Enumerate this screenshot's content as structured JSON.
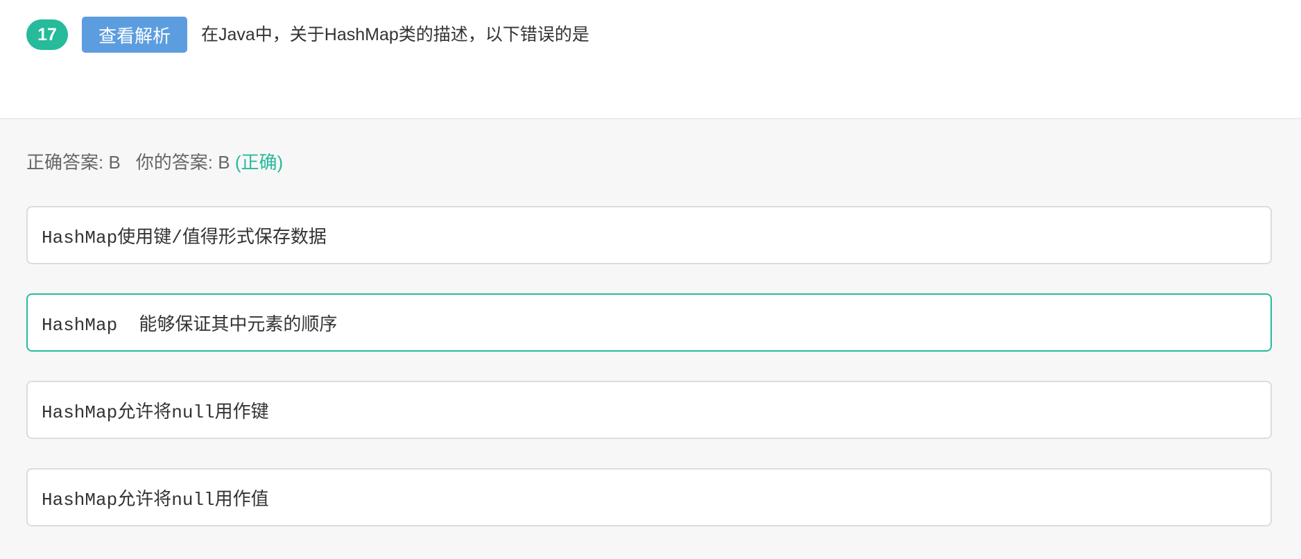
{
  "question": {
    "number": "17",
    "analysis_button_label": "查看解析",
    "text": "在Java中，关于HashMap类的描述，以下错误的是"
  },
  "answer": {
    "correct_label": "正确答案: B",
    "your_label": "你的答案: B",
    "result": "(正确)"
  },
  "options": [
    {
      "text": "HashMap使用键/值得形式保存数据"
    },
    {
      "text": "HashMap  能够保证其中元素的顺序",
      "selected": true
    },
    {
      "text": "HashMap允许将null用作键"
    },
    {
      "text": "HashMap允许将null用作值"
    }
  ],
  "colors": {
    "accent_green": "#25bb9b",
    "button_blue": "#5c9ddf"
  }
}
